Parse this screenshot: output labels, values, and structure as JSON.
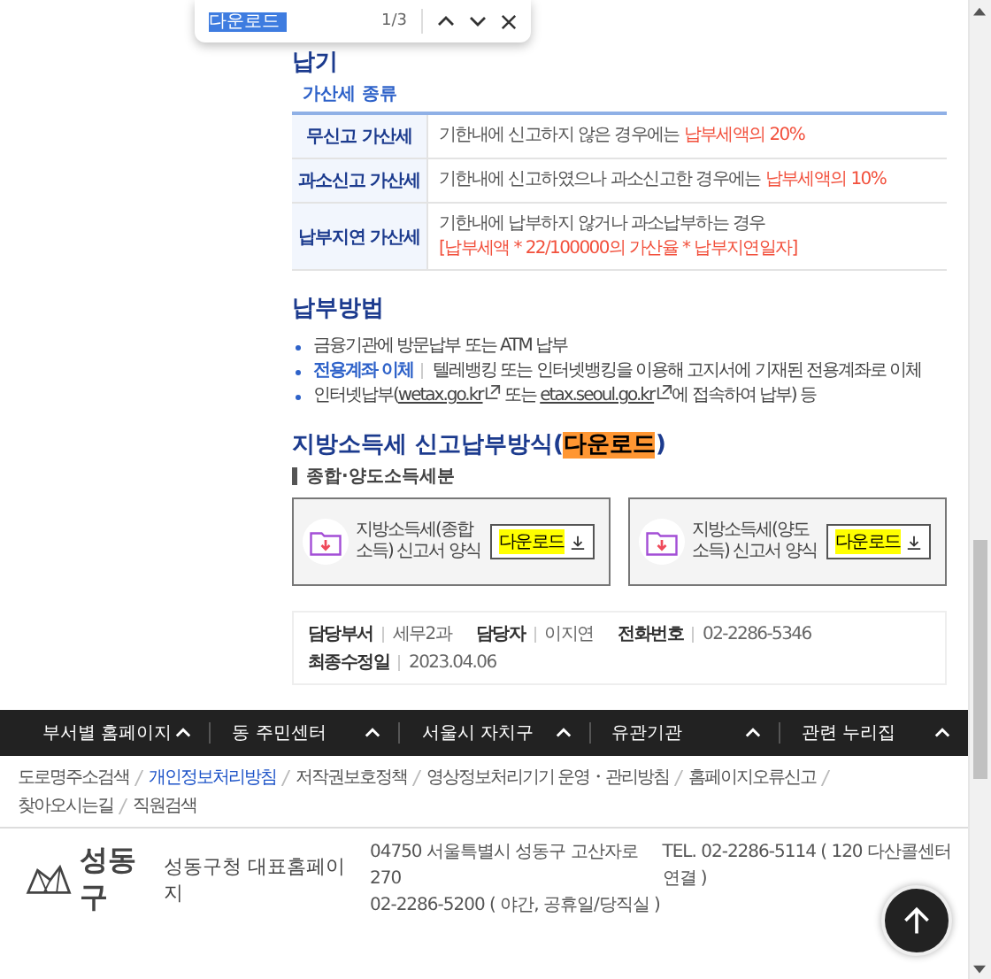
{
  "find_bar": {
    "query": "다운로드",
    "count": "1/3"
  },
  "payment_due": {
    "title": "납기",
    "bullet": "가산세 종류",
    "rows": [
      {
        "header": "무신고 가산세",
        "text": "기한내에 신고하지 않은 경우에는 ",
        "penalty": "납부세액의 20%",
        "penalty_on_new_line": false
      },
      {
        "header": "과소신고 가산세",
        "text": "기한내에 신고하였으나 과소신고한 경우에는 ",
        "penalty": "납부세액의 10%",
        "penalty_on_new_line": false
      },
      {
        "header": "납부지연 가산세",
        "text": "기한내에 납부하지 않거나 과소납부하는 경우",
        "penalty": "[납부세액 * 22/100000의 가산율 * 납부지연일자]",
        "penalty_on_new_line": true
      }
    ]
  },
  "payment_method": {
    "title": "납부방법",
    "items": [
      [
        {
          "kind": "text",
          "text": "금융기관에 방문납부 또는 ATM 납부"
        }
      ],
      [
        {
          "kind": "label",
          "text": "전용계좌 이체"
        },
        {
          "kind": "text",
          "text": "텔레뱅킹 또는 인터넷뱅킹을 이용해 고지서에 기재된 전용계좌로 이체"
        }
      ],
      [
        {
          "kind": "text",
          "text": "인터넷납부("
        },
        {
          "kind": "link",
          "text": "wetax.go.kr"
        },
        {
          "kind": "text",
          "text": " 또는 "
        },
        {
          "kind": "link",
          "text": "etax.seoul.go.kr"
        },
        {
          "kind": "text",
          "text": "에 접속하여 납부) 등"
        }
      ]
    ]
  },
  "forms": {
    "title": [
      {
        "kind": "text",
        "text": "지방소득세 신고납부방식("
      },
      {
        "kind": "match",
        "text": "다운로드"
      },
      {
        "kind": "text",
        "text": ")"
      }
    ],
    "subtitle": "종합·양도소득세분",
    "cards": [
      {
        "name": "지방소득세(종합소득) 신고서 양식",
        "button": "다운로드",
        "highlighted": true
      },
      {
        "name": "지방소득세(양도소득) 신고서 양식",
        "button": "다운로드",
        "highlighted": true
      }
    ]
  },
  "contact": [
    {
      "label": "담당부서",
      "value": "세무2과"
    },
    {
      "label": "담당자",
      "value": "이지연"
    },
    {
      "label": "전화번호",
      "value": "02-2286-5346"
    },
    {
      "label": "최종수정일",
      "value": "2023.04.06"
    }
  ],
  "footer_nav": [
    "부서별 홈페이지",
    "동 주민센터",
    "서울시 자치구",
    "유관기관",
    "관련 누리집"
  ],
  "footer_links": [
    {
      "label": "도로명주소검색",
      "selected": false
    },
    {
      "label": "개인정보처리방침",
      "selected": true
    },
    {
      "label": "저작권보호정책",
      "selected": false
    },
    {
      "label": "영상정보처리기기 운영・관리방침",
      "selected": false
    },
    {
      "label": "홈페이지오류신고",
      "selected": false
    },
    {
      "label": "찾아오시는길",
      "selected": false
    },
    {
      "label": "직원검색",
      "selected": false
    }
  ],
  "footer_info": {
    "logo_text": "성동구",
    "site_name": "성동구청 대표홈페이지",
    "address": "04750 서울특별시 성동구 고산자로 270",
    "tel": "TEL. 02-2286-5114 ( 120 다산콜센터 연결 )",
    "night_tel": "02-2286-5200 ( 야간, 공휴일/당직실 )"
  }
}
